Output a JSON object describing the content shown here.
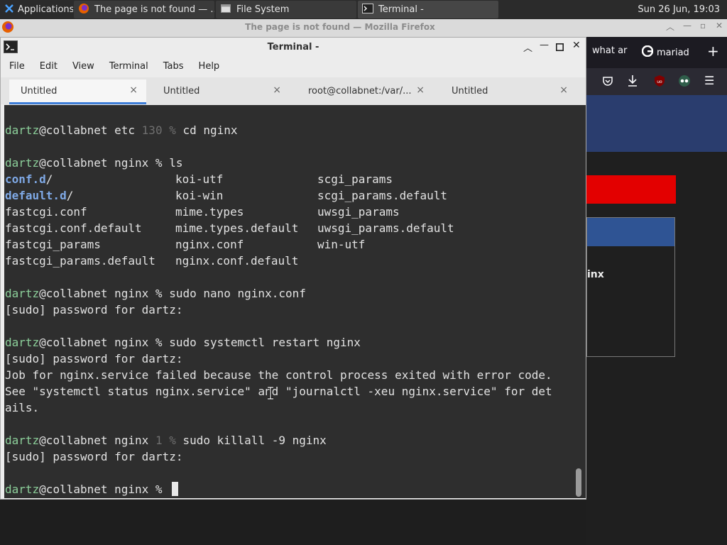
{
  "panel": {
    "applications_label": "Applications",
    "tasks": [
      {
        "label": "The page is not found — ...",
        "icon": "firefox-icon"
      },
      {
        "label": "File System",
        "icon": "folder-window-icon"
      },
      {
        "label": "Terminal -",
        "icon": "terminal-icon"
      }
    ],
    "clock": "Sun 26 Jun, 19:03"
  },
  "firefox": {
    "window_title": "The page is not found — Mozilla Firefox",
    "tabs": [
      "what ar",
      "mariad"
    ],
    "content_text": "inx"
  },
  "terminal": {
    "title": "Terminal -",
    "menu": [
      "File",
      "Edit",
      "View",
      "Terminal",
      "Tabs",
      "Help"
    ],
    "tabs": [
      {
        "label": "Untitled",
        "active": true
      },
      {
        "label": "Untitled",
        "active": false
      },
      {
        "label": "root@collabnet:/var/...",
        "active": false
      },
      {
        "label": "Untitled",
        "active": false
      }
    ],
    "close_glyph": "×",
    "lines": {
      "l1": {
        "user": "dartz",
        "host": "@collabnet etc ",
        "status": "130 %",
        "cmd": " cd nginx"
      },
      "l2": {
        "user": "dartz",
        "host": "@collabnet nginx % ",
        "cmd": "ls"
      },
      "ls_rows": [
        [
          "conf.d",
          "/",
          "koi-utf",
          "scgi_params"
        ],
        [
          "default.d",
          "/",
          "koi-win",
          "scgi_params.default"
        ],
        [
          "fastcgi.conf",
          "",
          "mime.types",
          "uwsgi_params"
        ],
        [
          "fastcgi.conf.default",
          "",
          "mime.types.default",
          "uwsgi_params.default"
        ],
        [
          "fastcgi_params",
          "",
          "nginx.conf",
          "win-utf"
        ],
        [
          "fastcgi_params.default",
          "",
          "nginx.conf.default",
          ""
        ]
      ],
      "l3": {
        "user": "dartz",
        "host": "@collabnet nginx % ",
        "cmd": "sudo nano nginx.conf"
      },
      "sudo1": "[sudo] password for dartz:",
      "l4": {
        "user": "dartz",
        "host": "@collabnet nginx % ",
        "cmd": "sudo systemctl restart nginx"
      },
      "sudo2": "[sudo] password for dartz:",
      "err1": "Job for nginx.service failed because the control process exited with error code.",
      "err2": "See \"systemctl status nginx.service\" and \"journalctl -xeu nginx.service\" for det",
      "err3": "ails.",
      "l5": {
        "user": "dartz",
        "host": "@collabnet nginx ",
        "status": "1 %",
        "cmd": " sudo killall -9 nginx"
      },
      "sudo3": "[sudo] password for dartz:",
      "l6": {
        "user": "dartz",
        "host": "@collabnet nginx % ",
        "cmd": ""
      }
    }
  },
  "colors": {
    "prompt_user": "#8ccf9a",
    "directory": "#7fa9e6",
    "terminal_bg": "#2e2e2e",
    "active_tab_indicator": "#3d7dd8",
    "ff_red_block": "#e30000",
    "ff_blue_header": "#2a3d6e"
  }
}
